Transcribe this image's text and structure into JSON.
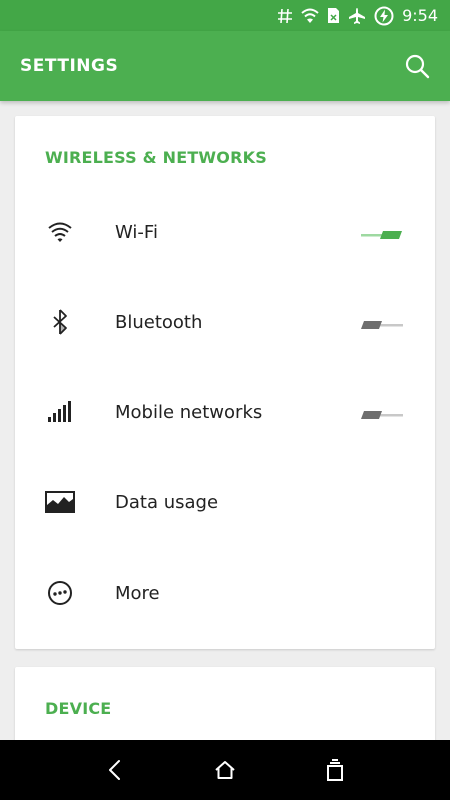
{
  "status_bar": {
    "time": "9:54",
    "icons": [
      "hash-icon",
      "wifi-icon",
      "sim-card-icon",
      "airplane-icon",
      "battery-charging-icon"
    ]
  },
  "app_bar": {
    "title": "SETTINGS",
    "search_icon": "search-icon"
  },
  "sections": {
    "wireless": {
      "header": "WIRELESS & NETWORKS",
      "items": [
        {
          "label": "Wi-Fi",
          "icon": "wifi-icon",
          "toggle": "on"
        },
        {
          "label": "Bluetooth",
          "icon": "bluetooth-icon",
          "toggle": "off"
        },
        {
          "label": "Mobile networks",
          "icon": "signal-icon",
          "toggle": "off"
        },
        {
          "label": "Data usage",
          "icon": "data-usage-icon"
        },
        {
          "label": "More",
          "icon": "more-icon"
        }
      ]
    },
    "device": {
      "header": "DEVICE"
    }
  },
  "nav_bar": {
    "icons": [
      "back-icon",
      "home-icon",
      "recents-icon"
    ]
  },
  "colors": {
    "accent": "#4caf50",
    "status_bar": "#43a747"
  }
}
